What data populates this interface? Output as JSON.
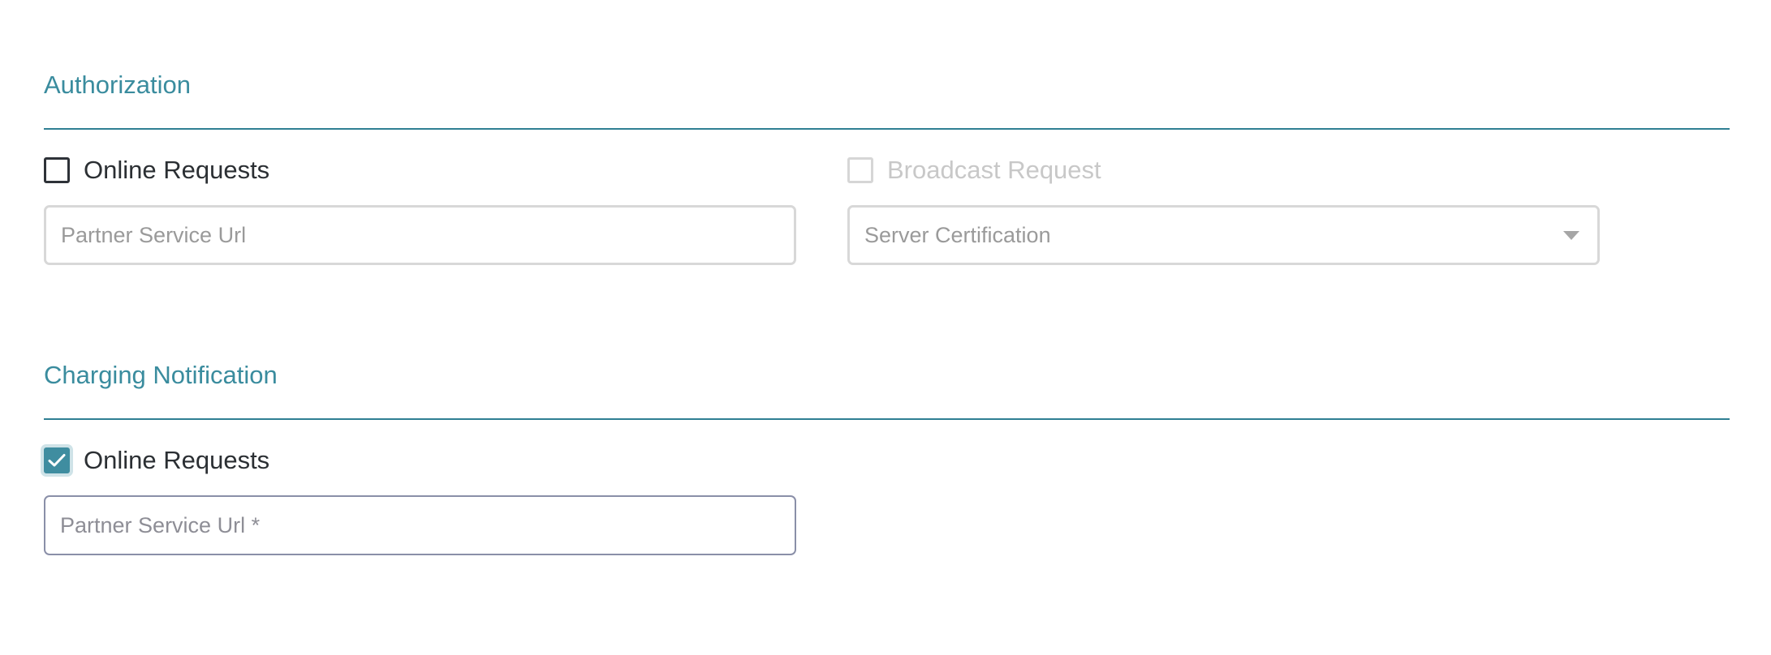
{
  "authorization": {
    "title": "Authorization",
    "online_requests": {
      "label": "Online Requests",
      "checked": false
    },
    "broadcast_request": {
      "label": "Broadcast Request",
      "checked": false,
      "disabled": true
    },
    "partner_service_url": {
      "placeholder": "Partner Service Url",
      "value": ""
    },
    "server_certification": {
      "placeholder": "Server Certification",
      "value": ""
    }
  },
  "charging_notification": {
    "title": "Charging Notification",
    "online_requests": {
      "label": "Online Requests",
      "checked": true
    },
    "partner_service_url": {
      "placeholder": "Partner Service Url *",
      "value": ""
    }
  },
  "colors": {
    "accent": "#3a8c9e",
    "rule": "#2f7f93",
    "checkbox_checked": "#3f8da0"
  },
  "icons": {
    "dropdown": "chevron-down-icon",
    "check": "check-icon"
  }
}
